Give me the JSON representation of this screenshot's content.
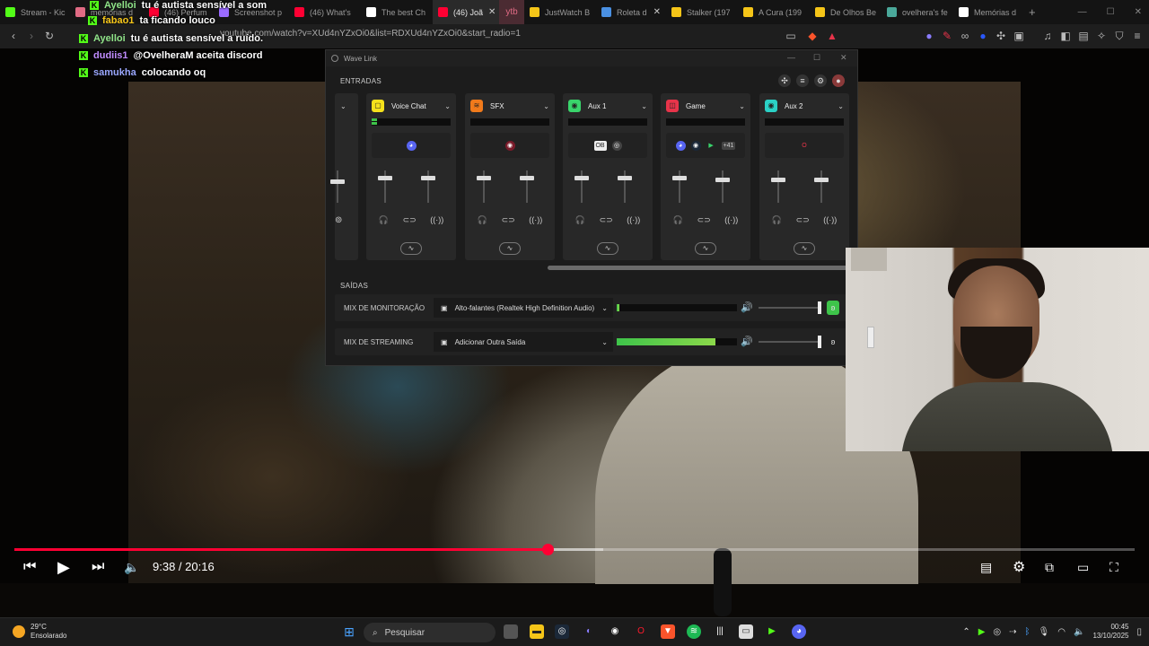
{
  "browser": {
    "tabs": [
      {
        "label": "Stream - Kic",
        "color": "#53fc18"
      },
      {
        "label": "memórias d",
        "color": "#e06b84"
      },
      {
        "label": "(46) Perfum",
        "color": "#ff0033"
      },
      {
        "label": "Screenshot p",
        "color": "#9a6bff"
      },
      {
        "label": "(46) What's",
        "color": "#ff0033"
      },
      {
        "label": "The best Ch",
        "color": "#ffffff"
      },
      {
        "label": "(46) Joã",
        "color": "#ff0033",
        "active": true
      },
      {
        "label": "ytb",
        "color": "#e06b84"
      },
      {
        "label": "JustWatch B",
        "color": "#f5c518"
      },
      {
        "label": "Roleta d",
        "color": "#4a90e2"
      },
      {
        "label": "Stalker (197",
        "color": "#f5c518"
      },
      {
        "label": "A Cura (199",
        "color": "#f5c518"
      },
      {
        "label": "De Olhos Be",
        "color": "#f5c518"
      },
      {
        "label": "ovelhera's fe",
        "color": "#4aa89a"
      },
      {
        "label": "Memórias d",
        "color": "#ffffff"
      }
    ],
    "new_tab": "+",
    "url": "youtube.com/watch?v=XUd4nYZxOi0&list=RDXUd4nYZxOi0&start_radio=1"
  },
  "chat": [
    {
      "user": "Ayelloi",
      "color": "#8fe388",
      "msg": "tu é autista sensível a som"
    },
    {
      "user": "fabao1",
      "color": "#f5c518",
      "msg": "ta ficando louco"
    },
    {
      "user": "Ayelloi",
      "color": "#8fe388",
      "msg": "tu é autista sensível a ruído."
    },
    {
      "user": "dudiis1",
      "color": "#c08cff",
      "msg": "@OvelheraM aceita discord"
    },
    {
      "user": "samukha",
      "color": "#9aa7ff",
      "msg": "colocando oq"
    }
  ],
  "player": {
    "time": "9:38 / 20:16",
    "progress_fraction": 0.476,
    "buffer_fraction": 0.526
  },
  "wavelink": {
    "title": "Wave Link",
    "entradas": "ENTRADAS",
    "saidas": "SAÍDAS",
    "inputs": [
      {
        "name": "Voice Chat",
        "icon_color": "#f5e11b",
        "icon": "chat-bubble-icon",
        "apps": [
          "discord-icon"
        ]
      },
      {
        "name": "SFX",
        "icon_color": "#f07a1b",
        "icon": "soundwave-icon",
        "apps": [
          "app-icon"
        ]
      },
      {
        "name": "Aux 1",
        "icon_color": "#39d46b",
        "icon": "circle-icon",
        "apps": [
          "obs-icon",
          "chrome-icon"
        ]
      },
      {
        "name": "Game",
        "icon_color": "#e8344a",
        "icon": "gamepad-icon",
        "apps": [
          "discord-icon",
          "steam-icon",
          "play-icon"
        ],
        "more": "+41"
      },
      {
        "name": "Aux 2",
        "icon_color": "#2bd1c6",
        "icon": "circle-icon",
        "apps": [
          "opera-icon"
        ]
      }
    ],
    "outputs": [
      {
        "label": "MIX DE MONITORAÇÃO",
        "device": "Alto-falantes (Realtek High Definition Audio)",
        "level": 0.02,
        "ear_color": "#3ec44a"
      },
      {
        "label": "MIX DE STREAMING",
        "device": "Adicionar Outra Saída",
        "level": 0.82,
        "ear_color": "transparent"
      }
    ]
  },
  "taskbar": {
    "temp": "29°C",
    "weather": "Ensolarado",
    "search": "Pesquisar",
    "time": "00:45",
    "date": "13/10/2025"
  }
}
